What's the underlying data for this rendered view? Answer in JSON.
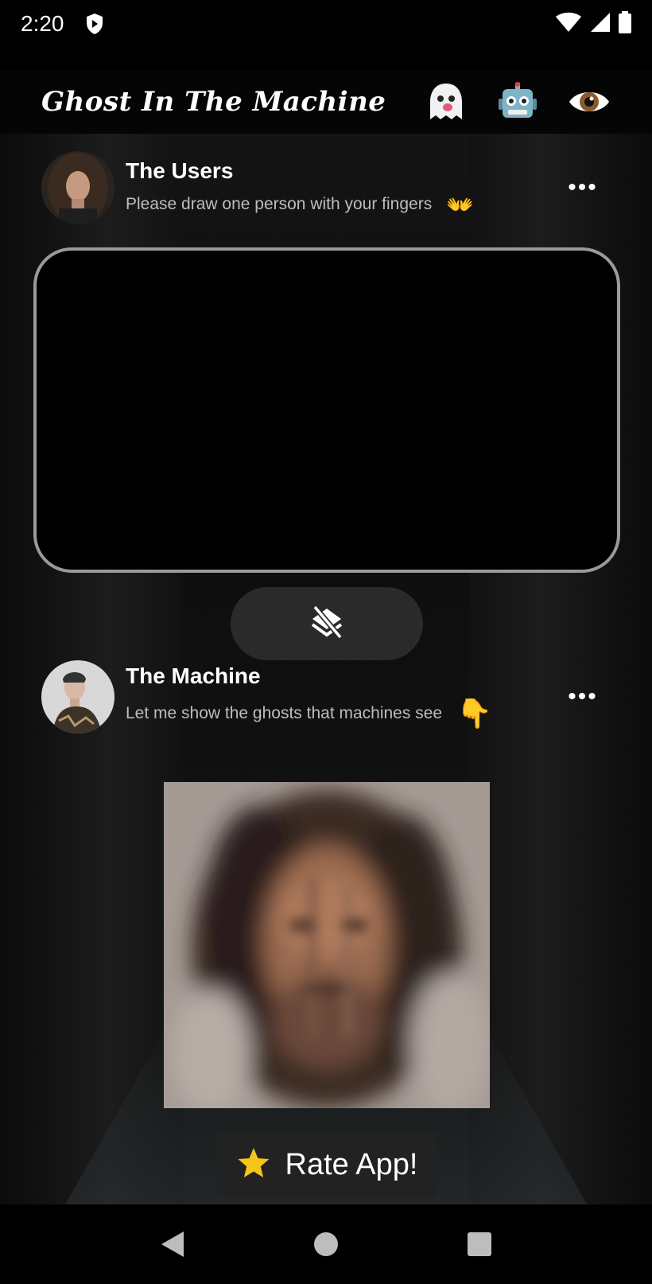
{
  "status_bar": {
    "time": "2:20",
    "icons": [
      "shield-icon",
      "wifi-icon",
      "signal-icon",
      "battery-icon"
    ]
  },
  "header": {
    "title": "Ghost In The Machine",
    "icons": [
      "ghost-icon",
      "robot-icon",
      "eye-icon"
    ]
  },
  "users_post": {
    "name": "The Users",
    "caption": "Please draw one person with your fingers",
    "emoji": "👐",
    "more": "•••"
  },
  "canvas": {
    "border_color": "#9a9a9a"
  },
  "toggle": {
    "icon": "layers-off-icon"
  },
  "machine_post": {
    "name": "The Machine",
    "caption": "Let me show the ghosts that machines see",
    "emoji": "👇",
    "more": "•••"
  },
  "rate": {
    "icon": "star-icon",
    "label": "Rate App!"
  },
  "nav": {
    "buttons": [
      "back-icon",
      "home-icon",
      "recents-icon"
    ]
  },
  "colors": {
    "background": "#000000",
    "button": "#2a2a2a",
    "star": "#f5c518"
  }
}
